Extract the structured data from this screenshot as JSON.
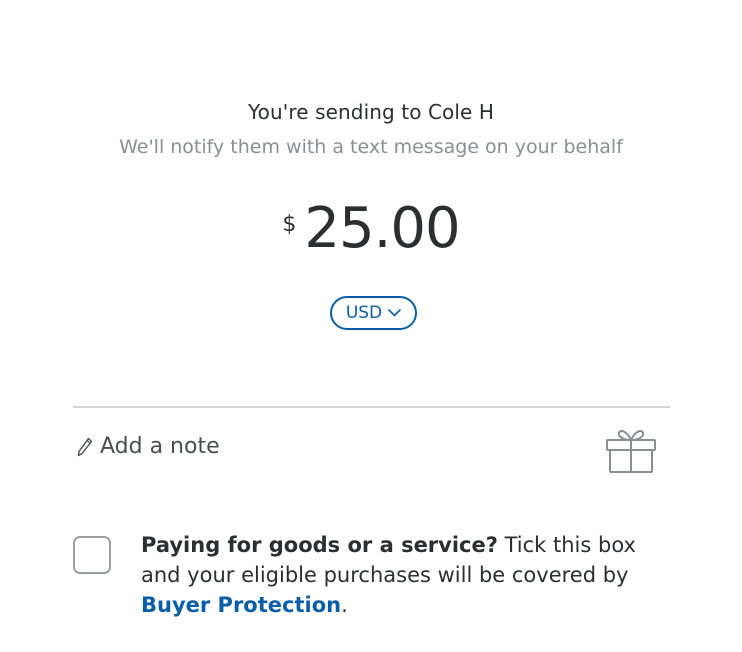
{
  "header": {
    "title": "You're sending to Cole H",
    "subtitle": "We'll notify them with a text message on your behalf"
  },
  "amount": {
    "symbol": "$",
    "value": "25.00",
    "currency": "USD"
  },
  "note": {
    "label": "Add a note",
    "icon": "pencil-icon"
  },
  "gift": {
    "icon": "gift-icon"
  },
  "protection": {
    "question": "Paying for goods or a service?",
    "text": " Tick this box and your eligible purchases will be covered by ",
    "link": "Buyer Protection",
    "end": "."
  },
  "colors": {
    "accent": "#0a5ea8",
    "text": "#2c2e2f",
    "muted": "#8a8f92",
    "divider": "#d6d8da"
  }
}
